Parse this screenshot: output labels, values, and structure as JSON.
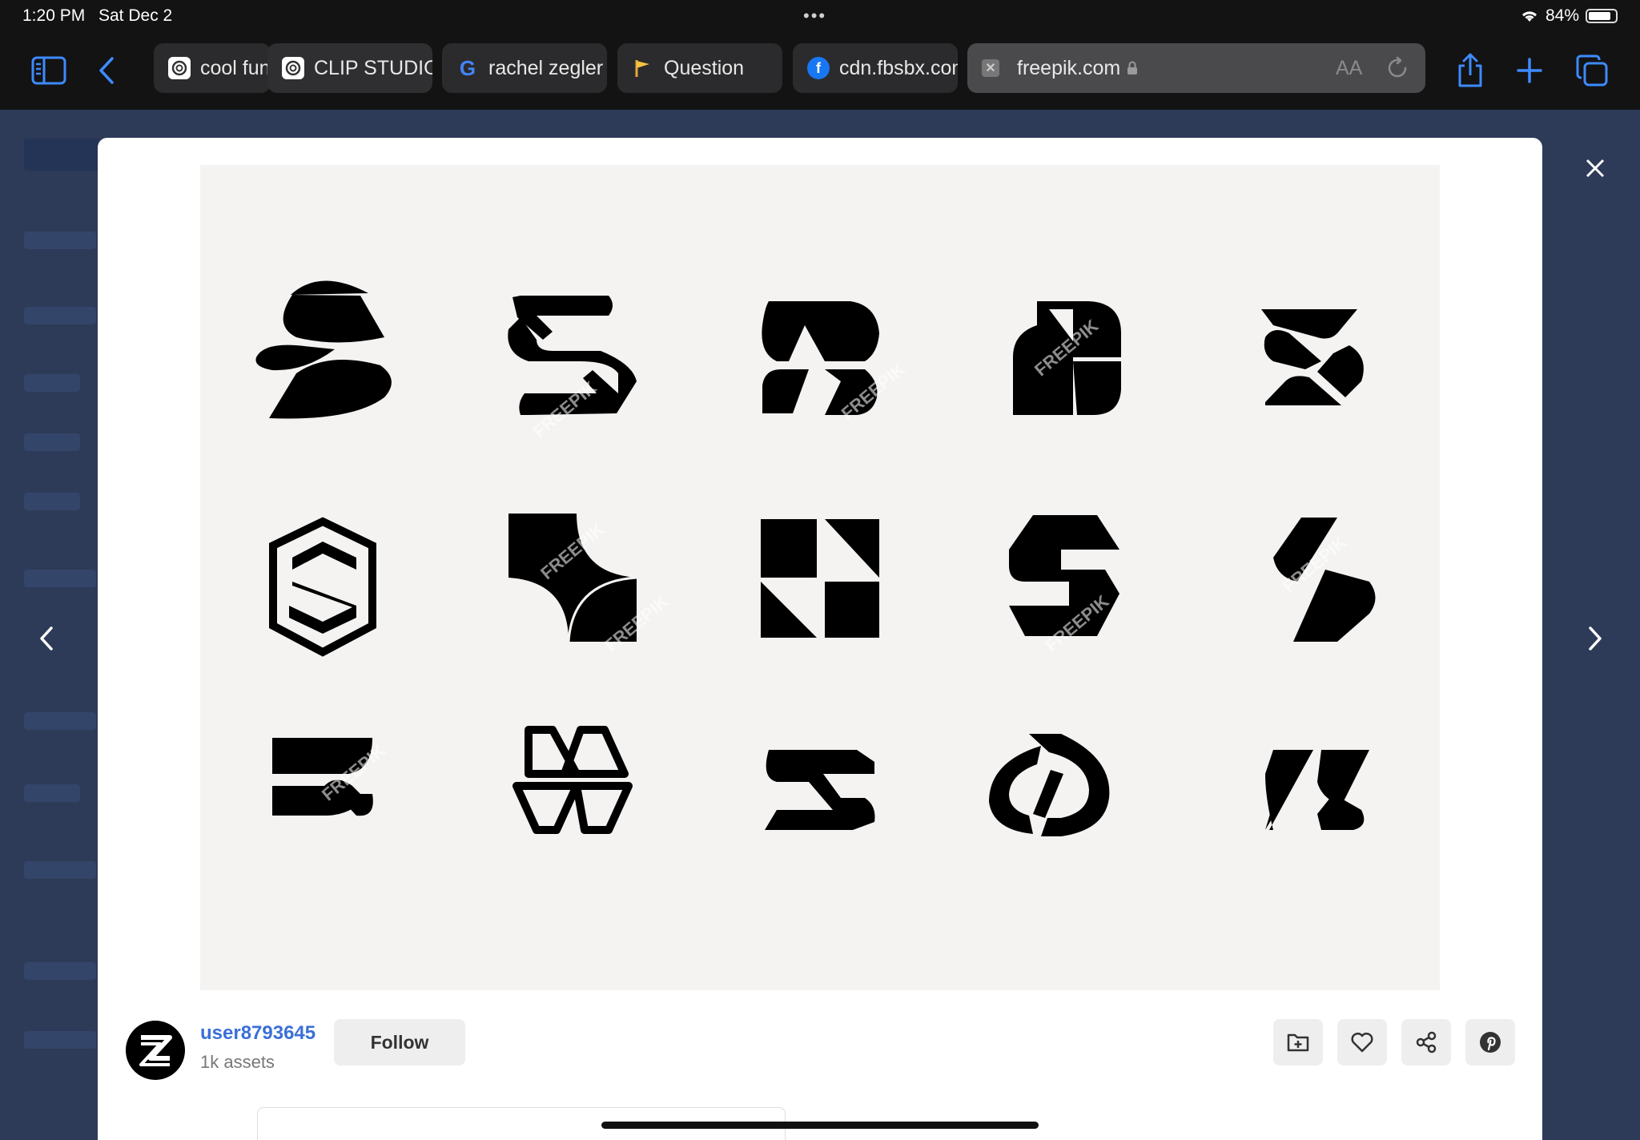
{
  "status_bar": {
    "time": "1:20 PM",
    "date": "Sat Dec 2",
    "battery": "84%",
    "battery_level": 0.84
  },
  "tabs": [
    {
      "label": "cool fun",
      "icon": "clip-studio-icon"
    },
    {
      "label": "CLIP STUDIO",
      "icon": "clip-studio-icon"
    },
    {
      "label": "rachel zegler",
      "icon": "google-icon"
    },
    {
      "label": "Question",
      "icon": "flag-icon"
    },
    {
      "label": "cdn.fbsbx.com",
      "icon": "facebook-icon"
    }
  ],
  "address_bar": {
    "url": "freepik.com",
    "text_size": "AA"
  },
  "preview": {
    "watermark": "FREEPIK"
  },
  "author": {
    "username": "user8793645",
    "assets": "1k assets",
    "follow_label": "Follow"
  },
  "colors": {
    "link": "#3a6fd8",
    "toolbar_accent": "#3d8bff"
  }
}
